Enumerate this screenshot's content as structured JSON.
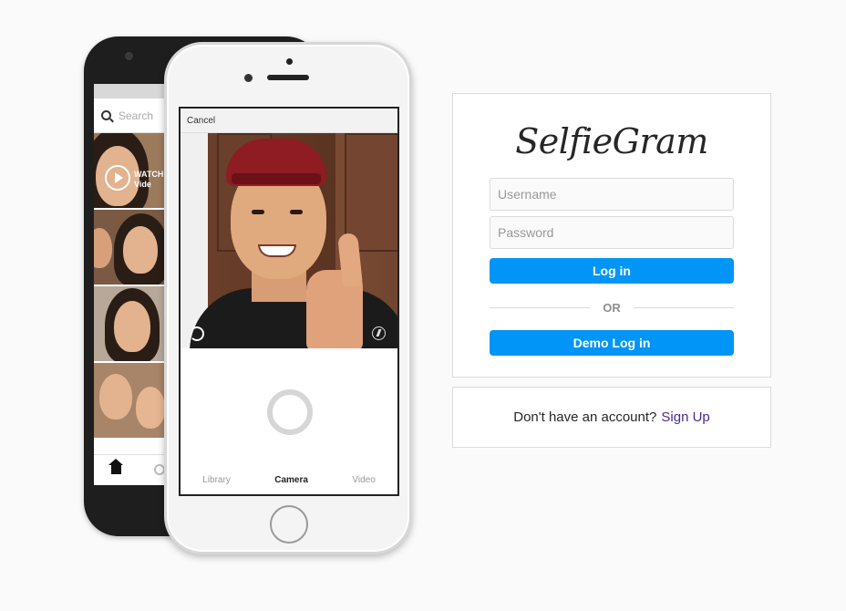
{
  "back_phone": {
    "search_placeholder": "Search",
    "video_overlay": "WATCH Vide"
  },
  "front_phone": {
    "cancel_label": "Cancel",
    "tabs": [
      "Library",
      "Camera",
      "Video"
    ],
    "active_tab": "Camera"
  },
  "login": {
    "logo": "SelfieGram",
    "username_placeholder": "Username",
    "password_placeholder": "Password",
    "login_button": "Log in",
    "or_text": "OR",
    "demo_button": "Demo Log in"
  },
  "signup": {
    "prompt": "Don't have an account?",
    "link": "Sign Up"
  },
  "colors": {
    "background": "#fafafa",
    "button_blue": "#0095f6",
    "link_purple": "#4b2a8c",
    "border": "#dbdbdb"
  }
}
